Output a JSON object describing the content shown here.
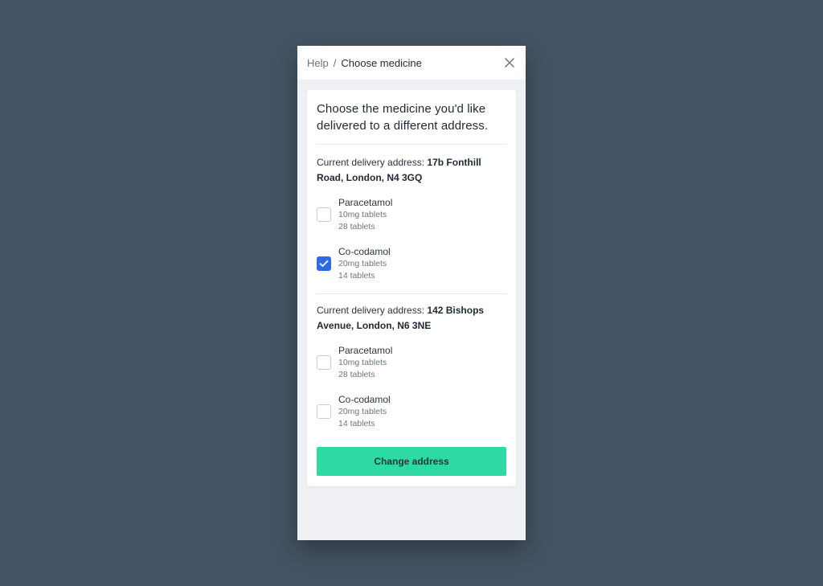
{
  "breadcrumb": {
    "parent": "Help",
    "separator": "/",
    "current": "Choose medicine"
  },
  "heading": "Choose the medicine you'd like delivered to a different address.",
  "groups": [
    {
      "address_label": "Current delivery address:",
      "address_value": "17b Fonthill Road, London, N4 3GQ",
      "items": [
        {
          "name": "Paracetamol",
          "strength": "10mg tablets",
          "quantity": "28 tablets",
          "checked": false
        },
        {
          "name": "Co-codamol",
          "strength": "20mg tablets",
          "quantity": "14 tablets",
          "checked": true
        }
      ]
    },
    {
      "address_label": "Current delivery address:",
      "address_value": "142 Bishops Avenue, London, N6 3NE",
      "items": [
        {
          "name": "Paracetamol",
          "strength": "10mg tablets",
          "quantity": "28 tablets",
          "checked": false
        },
        {
          "name": "Co-codamol",
          "strength": "20mg tablets",
          "quantity": "14 tablets",
          "checked": false
        }
      ]
    }
  ],
  "cta_label": "Change address",
  "colors": {
    "accent": "#2ed9a3",
    "checkbox_checked": "#2d6be3",
    "background": "#455464"
  },
  "icons": {
    "close": "close-icon",
    "check": "checkmark-icon"
  }
}
